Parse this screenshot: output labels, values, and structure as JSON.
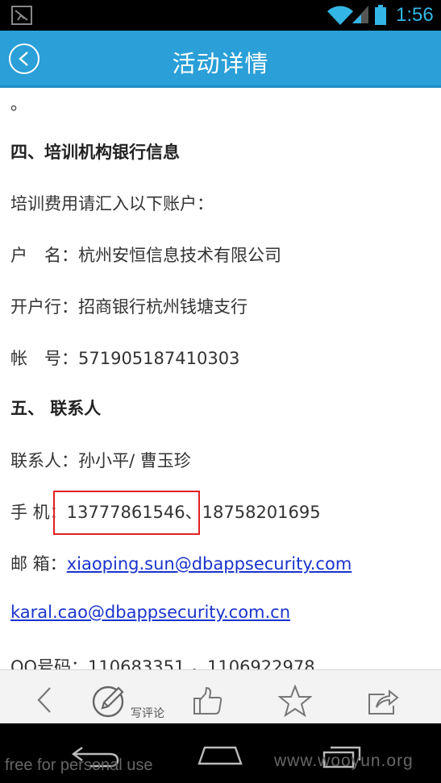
{
  "status_bar": {
    "time": "1:56",
    "icons": [
      "notification-icon",
      "wifi-icon",
      "signal-icon",
      "battery-icon"
    ]
  },
  "header": {
    "title": "活动详情",
    "back_icon": "back-arrow-icon"
  },
  "content": {
    "lines": [
      {
        "text": "。",
        "bold": false
      },
      {
        "text": "四、培训机构银行信息",
        "bold": true
      },
      {
        "text": "培训费用请汇入以下账户：",
        "bold": false
      },
      {
        "text": "户　名：杭州安恒信息技术有限公司",
        "bold": false
      },
      {
        "text": "开户行：招商银行杭州钱塘支行",
        "bold": false
      },
      {
        "text": "帐　号：571905187410303",
        "bold": false
      },
      {
        "text": "五、 联系人",
        "bold": true
      },
      {
        "text": "联系人：孙小平/ 曹玉珍",
        "bold": false
      },
      {
        "text": "手 机：13777861546、18758201695",
        "bold": false
      },
      {
        "prefix": "邮 箱：",
        "link": "xiaoping.sun@dbappsecurity.com"
      },
      {
        "link": "karal.cao@dbappsecurity.com.cn"
      },
      {
        "text": "QQ号码：110683351 ，1106922978",
        "bold": false
      }
    ]
  },
  "toolbar": {
    "back_icon": "chevron-left-icon",
    "comment_icon": "pencil-icon",
    "comment_label": "写评论",
    "like_icon": "thumbs-up-icon",
    "favorite_icon": "star-icon",
    "share_icon": "share-icon"
  },
  "nav": {
    "icons": [
      "back-nav-icon",
      "home-nav-icon",
      "recents-nav-icon"
    ]
  },
  "watermarks": {
    "left": "free for personal use",
    "right": "www.wooyun.org"
  },
  "colors": {
    "status_accent": "#33b5e5",
    "header_bg": "#2a9fd8",
    "link": "#1a33cc",
    "highlight": "#e02020"
  }
}
